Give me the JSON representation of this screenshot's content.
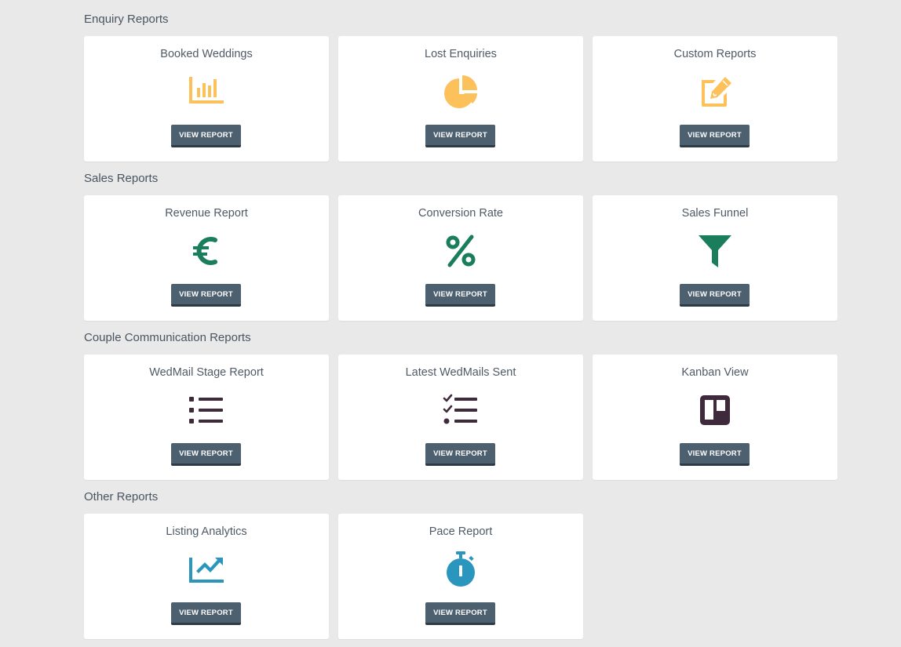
{
  "colors": {
    "page_background": "#e9e9e9",
    "button_background": "#4d6070",
    "icon_yellow": "#fcc15a",
    "icon_green": "#1a7d5b",
    "icon_dark": "#3f2a3c",
    "icon_blue": "#2a96bd"
  },
  "sections": [
    {
      "title": "Enquiry Reports",
      "cards": [
        {
          "title": "Booked Weddings",
          "icon": "bar-chart-icon",
          "button": "VIEW REPORT"
        },
        {
          "title": "Lost Enquiries",
          "icon": "pie-chart-icon",
          "button": "VIEW REPORT"
        },
        {
          "title": "Custom Reports",
          "icon": "edit-icon",
          "button": "VIEW REPORT"
        }
      ]
    },
    {
      "title": "Sales Reports",
      "cards": [
        {
          "title": "Revenue Report",
          "icon": "euro-icon",
          "button": "VIEW REPORT"
        },
        {
          "title": "Conversion Rate",
          "icon": "percent-icon",
          "button": "VIEW REPORT"
        },
        {
          "title": "Sales Funnel",
          "icon": "funnel-icon",
          "button": "VIEW REPORT"
        }
      ]
    },
    {
      "title": "Couple Communication Reports",
      "cards": [
        {
          "title": "WedMail Stage Report",
          "icon": "list-icon",
          "button": "VIEW REPORT"
        },
        {
          "title": "Latest WedMails Sent",
          "icon": "checklist-icon",
          "button": "VIEW REPORT"
        },
        {
          "title": "Kanban View",
          "icon": "kanban-board-icon",
          "button": "VIEW REPORT"
        }
      ]
    },
    {
      "title": "Other Reports",
      "cards": [
        {
          "title": "Listing Analytics",
          "icon": "line-chart-icon",
          "button": "VIEW REPORT"
        },
        {
          "title": "Pace Report",
          "icon": "stopwatch-icon",
          "button": "VIEW REPORT"
        }
      ]
    }
  ]
}
